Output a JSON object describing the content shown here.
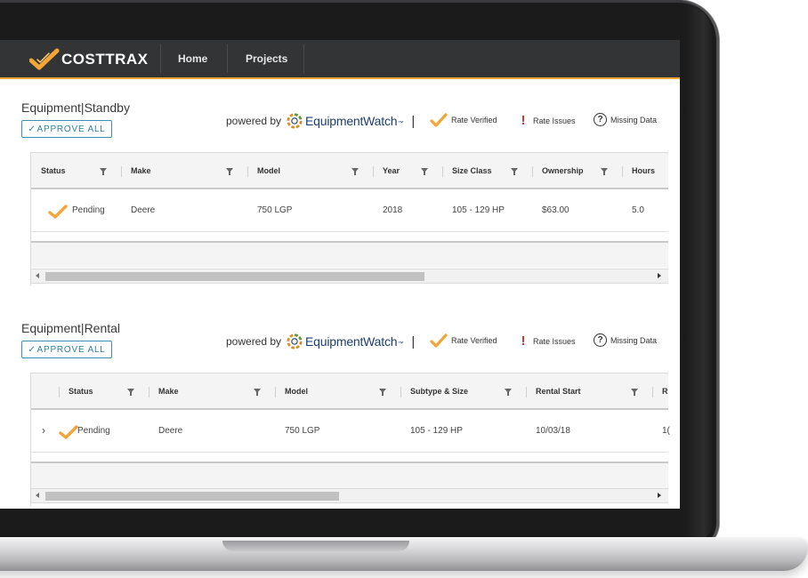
{
  "header": {
    "brand": "COSTTRAX",
    "nav": [
      {
        "label": "Home"
      },
      {
        "label": "Projects"
      }
    ]
  },
  "colors": {
    "accent": "#f3a536",
    "topbar": "#333436",
    "link_blue": "#2f7fa6",
    "issue_red": "#c0392b"
  },
  "standby": {
    "title": "Equipment|Standby",
    "approve_label": "APPROVE ALL",
    "powered_label": "powered by",
    "vendor": "EquipmentWatch",
    "legend": {
      "verified": "Rate Verified",
      "issues": "Rate Issues",
      "missing": "Missing Data"
    },
    "columns": [
      "Status",
      "Make",
      "Model",
      "Year",
      "Size Class",
      "Ownership",
      "Hours"
    ],
    "rows": [
      {
        "status": "Pending",
        "make": "Deere",
        "model": "750 LGP",
        "year": "2018",
        "size_class": "105 - 129 HP",
        "ownership": "$63.00",
        "hours": "5.0"
      }
    ]
  },
  "rental": {
    "title": "Equipment|Rental",
    "approve_label": "APPROVE ALL",
    "powered_label": "powered by",
    "vendor": "EquipmentWatch",
    "legend": {
      "verified": "Rate Verified",
      "issues": "Rate Issues",
      "missing": "Missing Data"
    },
    "columns": [
      "Status",
      "Make",
      "Model",
      "Subtype & Size",
      "Rental Start",
      "R"
    ],
    "rows": [
      {
        "status": "Pending",
        "make": "Deere",
        "model": "750 LGP",
        "subtype_size": "105 - 129 HP",
        "rental_start": "10/03/18",
        "rental_end_partial": "1("
      }
    ]
  }
}
